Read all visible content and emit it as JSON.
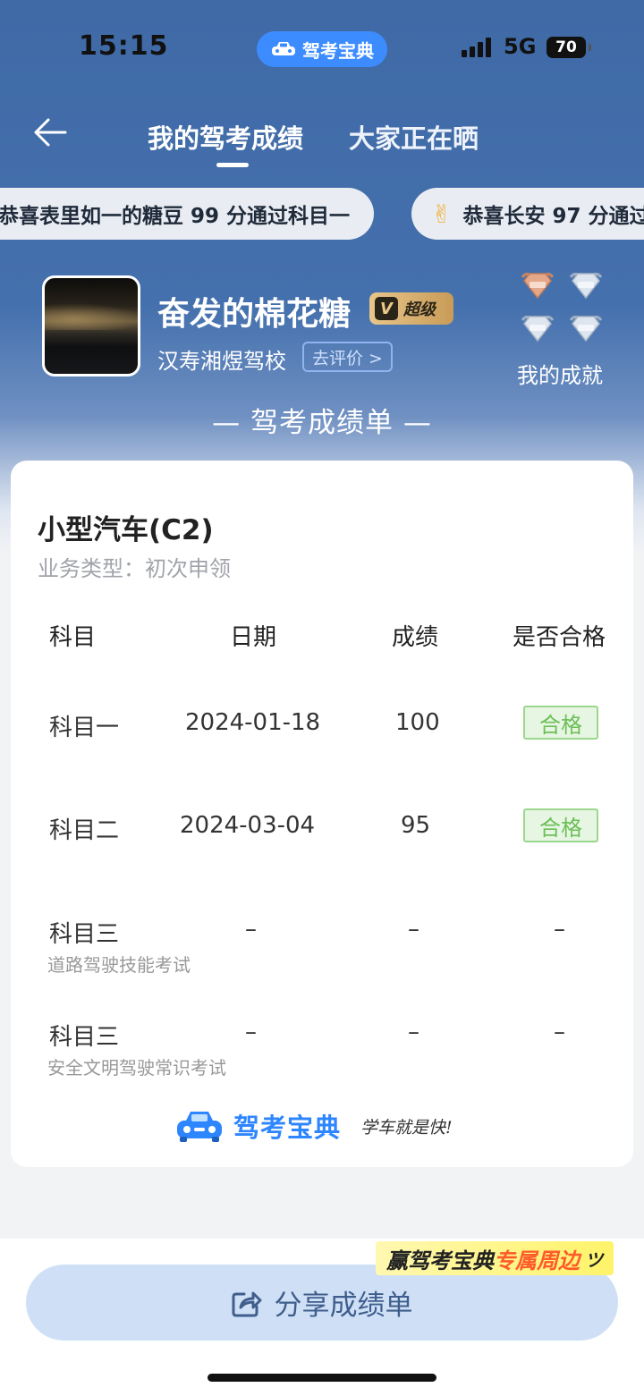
{
  "status_bar": {
    "time": "15:15",
    "app_badge": "驾考宝典",
    "network": "5G",
    "battery": "70"
  },
  "nav": {
    "tab_mine": "我的驾考成绩",
    "tab_all": "大家正在晒"
  },
  "marquee": [
    {
      "text": "恭喜表里如一的糖豆 99 分通过科目一"
    },
    {
      "icon": "✌",
      "text": "恭喜长安 97 分通过"
    }
  ],
  "profile": {
    "nickname": "奋发的棉花糖",
    "vip_label": "超级",
    "school": "汉寿湘煜驾校",
    "rate_button": "去评价 >",
    "achievement": "我的成就"
  },
  "sheet_title": "— 驾考成绩单 —",
  "card": {
    "license": "小型汽车(C2)",
    "business_type": "业务类型：初次申领",
    "headers": [
      "科目",
      "日期",
      "成绩",
      "是否合格"
    ],
    "rows": [
      {
        "subject": "科目一",
        "note": "",
        "date": "2024-01-18",
        "score": "100",
        "result": "合格"
      },
      {
        "subject": "科目二",
        "note": "",
        "date": "2024-03-04",
        "score": "95",
        "result": "合格"
      },
      {
        "subject": "科目三",
        "note": "道路驾驶技能考试",
        "date": "–",
        "score": "–",
        "result": "–"
      },
      {
        "subject": "科目三",
        "note": "安全文明驾驶常识考试",
        "date": "–",
        "score": "–",
        "result": "–"
      }
    ],
    "brand": "驾考宝典",
    "slogan": "学车就是快!"
  },
  "promo": {
    "part1": "赢驾考宝典",
    "part2": "专属周边",
    "deco": "ツ"
  },
  "share_button": "分享成绩单",
  "colors": {
    "hero_blue": "#4470ad",
    "accent_blue": "#2e86ff",
    "pass_green": "#6cbf58"
  }
}
